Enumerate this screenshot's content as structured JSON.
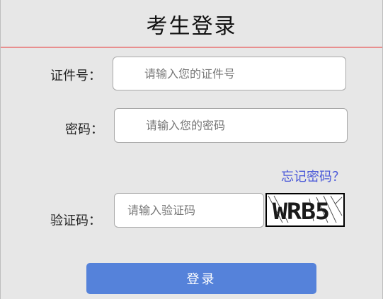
{
  "page": {
    "title": "考生登录"
  },
  "form": {
    "id_label": "证件号：",
    "id_placeholder": "请输入您的证件号",
    "password_label": "密码：",
    "password_placeholder": "请输入您的密码",
    "forgot_link": "忘记密码？",
    "captcha_label": "验证码：",
    "captcha_placeholder": "请输入验证码",
    "captcha_text": "WRB5",
    "submit_label": "登录"
  },
  "colors": {
    "panel_background": "#e7e7e7",
    "divider": "#e88f8f",
    "link": "#4a58d8",
    "submit_button": "#5582da"
  }
}
